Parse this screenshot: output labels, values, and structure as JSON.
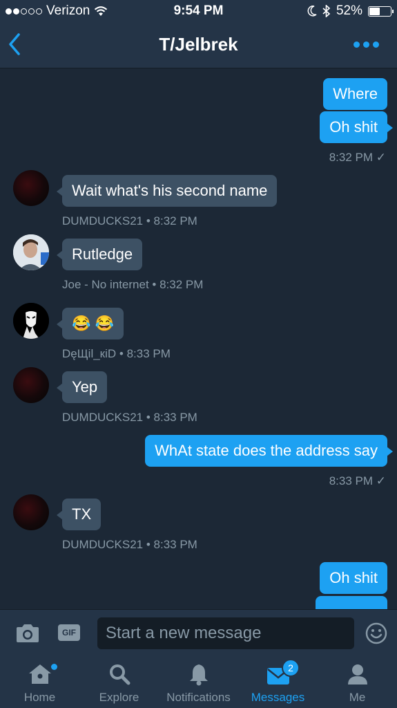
{
  "status_bar": {
    "carrier": "Verizon",
    "time": "9:54 PM",
    "battery_percent": "52%",
    "battery_level": 0.52,
    "signal_bars_filled": 2,
    "icons": [
      "signal-dots-icon",
      "wifi-icon",
      "moon-icon",
      "bluetooth-icon",
      "battery-icon"
    ]
  },
  "header": {
    "title": "T/Jelbrek",
    "back_icon": "chevron-left-icon",
    "more_icon": "more-dots-icon"
  },
  "messages": [
    {
      "type": "sent",
      "text": "Where"
    },
    {
      "type": "sent",
      "text": "Oh shit",
      "meta": "8:32 PM ✓"
    },
    {
      "type": "received",
      "sender": "DUMDUCKS21",
      "text": "Wait what's his second name",
      "meta": "DUMDUCKS21 • 8:32 PM"
    },
    {
      "type": "received",
      "sender": "Joe - No internet",
      "text": "Rutledge",
      "meta": "Joe - No internet • 8:32 PM"
    },
    {
      "type": "received",
      "sender": "DęЩil_кiD",
      "text": "😂 😂",
      "meta": "DęЩil_кiD • 8:33 PM"
    },
    {
      "type": "received",
      "sender": "DUMDUCKS21",
      "text": "Yep",
      "meta": "DUMDUCKS21 • 8:33 PM"
    },
    {
      "type": "sent",
      "text": "WhAt state does the address say",
      "meta": "8:33 PM ✓"
    },
    {
      "type": "received",
      "sender": "DUMDUCKS21",
      "text": "TX",
      "meta": "DUMDUCKS21 • 8:33 PM"
    },
    {
      "type": "sent",
      "text": "Oh shit"
    }
  ],
  "composer": {
    "placeholder": "Start a new message",
    "gif_label": "GIF",
    "camera_icon": "camera-icon",
    "emoji_icon": "emoji-icon"
  },
  "tabs": [
    {
      "label": "Home",
      "icon": "home-icon",
      "has_dot": true
    },
    {
      "label": "Explore",
      "icon": "search-icon"
    },
    {
      "label": "Notifications",
      "icon": "bell-icon"
    },
    {
      "label": "Messages",
      "icon": "envelope-icon",
      "active": true,
      "badge": "2"
    },
    {
      "label": "Me",
      "icon": "person-icon"
    }
  ],
  "colors": {
    "accent": "#1da1f2",
    "background": "#1c2836",
    "bar": "#243447",
    "received_bubble": "#3d5164",
    "muted_text": "#8899a6"
  }
}
